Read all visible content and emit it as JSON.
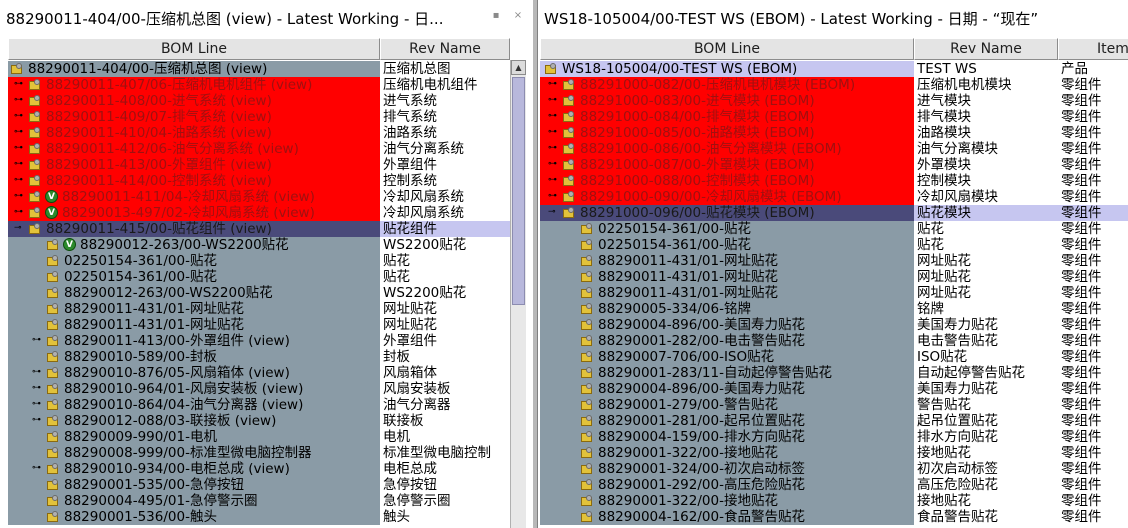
{
  "left_pane": {
    "title": "88290011-404/00-压缩机总图 (view) - Latest Working - 日...",
    "columns": {
      "bom_line": "BOM Line",
      "rev_name": "Rev Name"
    },
    "rows": [
      {
        "indent": 0,
        "exp": "",
        "icon": "root",
        "v": false,
        "bom": "88290011-404/00-压缩机总图 (view)",
        "rev": "压缩机总图",
        "style": "rootL"
      },
      {
        "indent": 1,
        "exp": "⊶",
        "icon": "part",
        "v": false,
        "bom": "88290011-407/06-压缩机电机组件 (view)",
        "rev": "压缩机电机组件",
        "style": "red"
      },
      {
        "indent": 1,
        "exp": "⊶",
        "icon": "part",
        "v": false,
        "bom": "88290011-408/00-进气系统 (view)",
        "rev": "进气系统",
        "style": "red"
      },
      {
        "indent": 1,
        "exp": "⊶",
        "icon": "part",
        "v": false,
        "bom": "88290011-409/07-排气系统 (view)",
        "rev": "排气系统",
        "style": "red"
      },
      {
        "indent": 1,
        "exp": "⊶",
        "icon": "part",
        "v": false,
        "bom": "88290011-410/04-油路系统 (view)",
        "rev": "油路系统",
        "style": "red"
      },
      {
        "indent": 1,
        "exp": "⊶",
        "icon": "part",
        "v": false,
        "bom": "88290011-412/06-油气分离系统 (view)",
        "rev": "油气分离系统",
        "style": "red"
      },
      {
        "indent": 1,
        "exp": "⊶",
        "icon": "part",
        "v": false,
        "bom": "88290011-413/00-外罩组件 (view)",
        "rev": "外罩组件",
        "style": "red"
      },
      {
        "indent": 1,
        "exp": "⊶",
        "icon": "part",
        "v": false,
        "bom": "88290011-414/00-控制系统 (view)",
        "rev": "控制系统",
        "style": "red"
      },
      {
        "indent": 1,
        "exp": "⊶",
        "icon": "part",
        "v": true,
        "bom": "88290011-411/04-冷却风扇系统 (view)",
        "rev": "冷却风扇系统",
        "style": "red"
      },
      {
        "indent": 1,
        "exp": "⊶",
        "icon": "part",
        "v": true,
        "bom": "88290013-497/02-冷却风扇系统 (view)",
        "rev": "冷却风扇系统",
        "style": "red"
      },
      {
        "indent": 1,
        "exp": "⊸",
        "icon": "part",
        "v": false,
        "bom": "88290011-415/00-贴花组件 (view)",
        "rev": "贴花组件",
        "style": "sel"
      },
      {
        "indent": 2,
        "exp": "",
        "icon": "part",
        "v": true,
        "bom": "88290012-263/00-WS2200贴花",
        "rev": "WS2200贴花",
        "style": "gray"
      },
      {
        "indent": 2,
        "exp": "",
        "icon": "part",
        "v": false,
        "bom": "02250154-361/00-贴花",
        "rev": "贴花",
        "style": "gray"
      },
      {
        "indent": 2,
        "exp": "",
        "icon": "part",
        "v": false,
        "bom": "02250154-361/00-贴花",
        "rev": "贴花",
        "style": "gray"
      },
      {
        "indent": 2,
        "exp": "",
        "icon": "part",
        "v": false,
        "bom": "88290012-263/00-WS2200贴花",
        "rev": "WS2200贴花",
        "style": "gray"
      },
      {
        "indent": 2,
        "exp": "",
        "icon": "part",
        "v": false,
        "bom": "88290011-431/01-网址贴花",
        "rev": "网址贴花",
        "style": "gray"
      },
      {
        "indent": 2,
        "exp": "",
        "icon": "part",
        "v": false,
        "bom": "88290011-431/01-网址贴花",
        "rev": "网址贴花",
        "style": "gray"
      },
      {
        "indent": 2,
        "exp": "⊶",
        "icon": "part",
        "v": false,
        "bom": "88290011-413/00-外罩组件 (view)",
        "rev": "外罩组件",
        "style": "gray"
      },
      {
        "indent": 2,
        "exp": "",
        "icon": "part",
        "v": false,
        "bom": "88290010-589/00-封板",
        "rev": "封板",
        "style": "gray"
      },
      {
        "indent": 2,
        "exp": "⊶",
        "icon": "part",
        "v": false,
        "bom": "88290010-876/05-风扇箱体 (view)",
        "rev": "风扇箱体",
        "style": "gray"
      },
      {
        "indent": 2,
        "exp": "⊶",
        "icon": "part",
        "v": false,
        "bom": "88290010-964/01-风扇安装板 (view)",
        "rev": "风扇安装板",
        "style": "gray"
      },
      {
        "indent": 2,
        "exp": "⊶",
        "icon": "part",
        "v": false,
        "bom": "88290010-864/04-油气分离器 (view)",
        "rev": "油气分离器",
        "style": "gray"
      },
      {
        "indent": 2,
        "exp": "⊶",
        "icon": "part",
        "v": false,
        "bom": "88290012-088/03-联接板 (view)",
        "rev": "联接板",
        "style": "gray"
      },
      {
        "indent": 2,
        "exp": "",
        "icon": "part",
        "v": false,
        "bom": "88290009-990/01-电机",
        "rev": "电机",
        "style": "gray"
      },
      {
        "indent": 2,
        "exp": "",
        "icon": "part",
        "v": false,
        "bom": "88290008-999/00-标准型微电脑控制器",
        "rev": "标准型微电脑控制",
        "style": "gray"
      },
      {
        "indent": 2,
        "exp": "⊶",
        "icon": "part",
        "v": false,
        "bom": "88290010-934/00-电柜总成 (view)",
        "rev": "电柜总成",
        "style": "gray"
      },
      {
        "indent": 2,
        "exp": "",
        "icon": "part",
        "v": false,
        "bom": "88290001-535/00-急停按钮",
        "rev": "急停按钮",
        "style": "gray"
      },
      {
        "indent": 2,
        "exp": "",
        "icon": "part",
        "v": false,
        "bom": "88290004-495/01-急停警示圈",
        "rev": "急停警示圈",
        "style": "gray"
      },
      {
        "indent": 2,
        "exp": "",
        "icon": "part",
        "v": false,
        "bom": "88290001-536/00-触头",
        "rev": "触头",
        "style": "gray"
      }
    ]
  },
  "right_pane": {
    "title": "WS18-105004/00-TEST WS (EBOM) - Latest Working - 日期 - “现在”",
    "columns": {
      "bom_line": "BOM Line",
      "rev_name": "Rev Name",
      "item": "Item"
    },
    "rows": [
      {
        "indent": 0,
        "exp": "",
        "icon": "root",
        "bom": "WS18-105004/00-TEST WS (EBOM)",
        "rev": "TEST WS",
        "item": "产品",
        "style": "root"
      },
      {
        "indent": 1,
        "exp": "⊶",
        "icon": "part",
        "bom": "88291000-082/00-压缩机电机模块 (EBOM)",
        "rev": "压缩机电机模块",
        "item": "零组件",
        "style": "red"
      },
      {
        "indent": 1,
        "exp": "⊶",
        "icon": "part",
        "bom": "88291000-083/00-进气模块 (EBOM)",
        "rev": "进气模块",
        "item": "零组件",
        "style": "red"
      },
      {
        "indent": 1,
        "exp": "⊶",
        "icon": "part",
        "bom": "88291000-084/00-排气模块 (EBOM)",
        "rev": "排气模块",
        "item": "零组件",
        "style": "red"
      },
      {
        "indent": 1,
        "exp": "⊶",
        "icon": "part",
        "bom": "88291000-085/00-油路模块 (EBOM)",
        "rev": "油路模块",
        "item": "零组件",
        "style": "red"
      },
      {
        "indent": 1,
        "exp": "⊶",
        "icon": "part",
        "bom": "88291000-086/00-油气分离模块 (EBOM)",
        "rev": "油气分离模块",
        "item": "零组件",
        "style": "red"
      },
      {
        "indent": 1,
        "exp": "⊶",
        "icon": "part",
        "bom": "88291000-087/00-外罩模块 (EBOM)",
        "rev": "外罩模块",
        "item": "零组件",
        "style": "red"
      },
      {
        "indent": 1,
        "exp": "⊶",
        "icon": "part",
        "bom": "88291000-088/00-控制模块 (EBOM)",
        "rev": "控制模块",
        "item": "零组件",
        "style": "red"
      },
      {
        "indent": 1,
        "exp": "⊶",
        "icon": "part",
        "bom": "88291000-090/00-冷却风扇模块 (EBOM)",
        "rev": "冷却风扇模块",
        "item": "零组件",
        "style": "red"
      },
      {
        "indent": 1,
        "exp": "⊸",
        "icon": "part",
        "bom": "88291000-096/00-贴花模块 (EBOM)",
        "rev": "贴花模块",
        "item": "零组件",
        "style": "sel"
      },
      {
        "indent": 2,
        "exp": "",
        "icon": "part",
        "bom": "02250154-361/00-贴花",
        "rev": "贴花",
        "item": "零组件",
        "style": "gray"
      },
      {
        "indent": 2,
        "exp": "",
        "icon": "part",
        "bom": "02250154-361/00-贴花",
        "rev": "贴花",
        "item": "零组件",
        "style": "gray"
      },
      {
        "indent": 2,
        "exp": "",
        "icon": "part",
        "bom": "88290011-431/01-网址贴花",
        "rev": "网址贴花",
        "item": "零组件",
        "style": "gray"
      },
      {
        "indent": 2,
        "exp": "",
        "icon": "part",
        "bom": "88290011-431/01-网址贴花",
        "rev": "网址贴花",
        "item": "零组件",
        "style": "gray"
      },
      {
        "indent": 2,
        "exp": "",
        "icon": "part",
        "bom": "88290011-431/01-网址贴花",
        "rev": "网址贴花",
        "item": "零组件",
        "style": "gray"
      },
      {
        "indent": 2,
        "exp": "",
        "icon": "part",
        "bom": "88290005-334/06-铭牌",
        "rev": "铭牌",
        "item": "零组件",
        "style": "gray"
      },
      {
        "indent": 2,
        "exp": "",
        "icon": "part",
        "bom": "88290004-896/00-美国寿力贴花",
        "rev": "美国寿力贴花",
        "item": "零组件",
        "style": "gray"
      },
      {
        "indent": 2,
        "exp": "",
        "icon": "part",
        "bom": "88290001-282/00-电击警告贴花",
        "rev": "电击警告贴花",
        "item": "零组件",
        "style": "gray"
      },
      {
        "indent": 2,
        "exp": "",
        "icon": "part",
        "bom": "88290007-706/00-ISO贴花",
        "rev": "ISO贴花",
        "item": "零组件",
        "style": "gray"
      },
      {
        "indent": 2,
        "exp": "",
        "icon": "part",
        "bom": "88290001-283/11-自动起停警告贴花",
        "rev": "自动起停警告贴花",
        "item": "零组件",
        "style": "gray"
      },
      {
        "indent": 2,
        "exp": "",
        "icon": "part",
        "bom": "88290004-896/00-美国寿力贴花",
        "rev": "美国寿力贴花",
        "item": "零组件",
        "style": "gray"
      },
      {
        "indent": 2,
        "exp": "",
        "icon": "part",
        "bom": "88290001-279/00-警告贴花",
        "rev": "警告贴花",
        "item": "零组件",
        "style": "gray"
      },
      {
        "indent": 2,
        "exp": "",
        "icon": "part",
        "bom": "88290001-281/00-起吊位置贴花",
        "rev": "起吊位置贴花",
        "item": "零组件",
        "style": "gray"
      },
      {
        "indent": 2,
        "exp": "",
        "icon": "part",
        "bom": "88290004-159/00-排水方向贴花",
        "rev": "排水方向贴花",
        "item": "零组件",
        "style": "gray"
      },
      {
        "indent": 2,
        "exp": "",
        "icon": "part",
        "bom": "88290001-322/00-接地贴花",
        "rev": "接地贴花",
        "item": "零组件",
        "style": "gray"
      },
      {
        "indent": 2,
        "exp": "",
        "icon": "part",
        "bom": "88290001-324/00-初次启动标签",
        "rev": "初次启动标签",
        "item": "零组件",
        "style": "gray"
      },
      {
        "indent": 2,
        "exp": "",
        "icon": "part",
        "bom": "88290001-292/00-高压危险贴花",
        "rev": "高压危险贴花",
        "item": "零组件",
        "style": "gray"
      },
      {
        "indent": 2,
        "exp": "",
        "icon": "part",
        "bom": "88290001-322/00-接地贴花",
        "rev": "接地贴花",
        "item": "零组件",
        "style": "gray"
      },
      {
        "indent": 2,
        "exp": "",
        "icon": "part",
        "bom": "88290004-162/00-食品警告贴花",
        "rev": "食品警告贴花",
        "item": "零组件",
        "style": "gray"
      }
    ]
  },
  "window_buttons": {
    "minimize": "▪",
    "close": "×"
  },
  "scrollbar": {
    "up_arrow": "▲"
  },
  "colors": {
    "changed_row": "#ff0000",
    "unchanged_row": "#8a9ba6",
    "selected_row": "#4a4a7a",
    "selection_highlight": "#c6c6f0"
  }
}
